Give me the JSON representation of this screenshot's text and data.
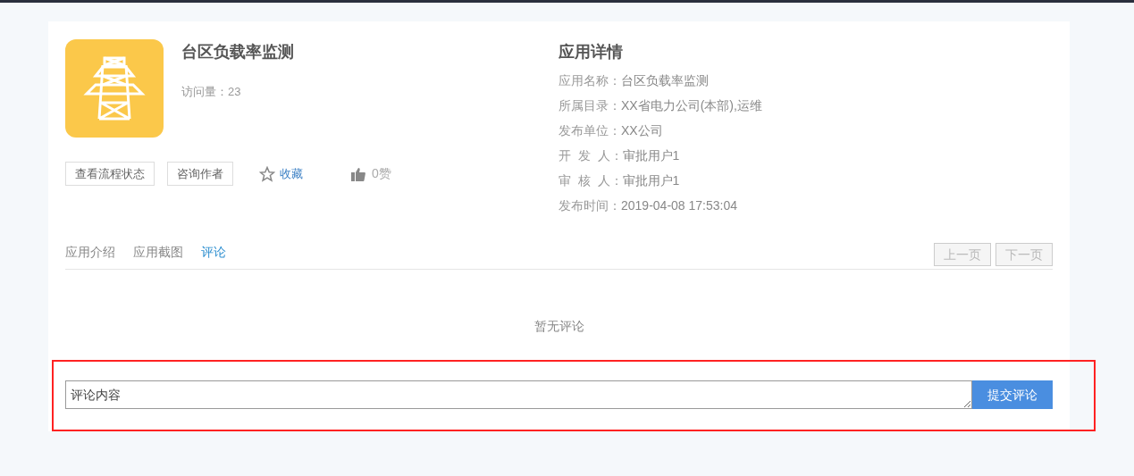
{
  "app": {
    "title": "台区负载率监测",
    "visits": "访问量：23"
  },
  "actions": [
    {
      "kind": "outlined",
      "label": "查看流程状态"
    },
    {
      "kind": "outlined",
      "label": "咨询作者"
    },
    {
      "kind": "favorite",
      "label": "收藏"
    },
    {
      "kind": "like",
      "label": "0赞"
    }
  ],
  "details": {
    "title": "应用详情",
    "rows": [
      {
        "label": "应用名称：",
        "value": "台区负载率监测"
      },
      {
        "label": "所属目录：",
        "value": "XX省电力公司(本部),运维"
      },
      {
        "label": "发布单位：",
        "value": "XX公司"
      },
      {
        "label": "开  发  人：",
        "value": "审批用户1"
      },
      {
        "label": "审  核  人：",
        "value": "审批用户1"
      },
      {
        "label": "发布时间：",
        "value": "2019-04-08 17:53:04"
      }
    ]
  },
  "tabs": [
    {
      "label": "应用介绍",
      "selected": false
    },
    {
      "label": "应用截图",
      "selected": false
    },
    {
      "label": "评论",
      "selected": true
    }
  ],
  "pager": [
    {
      "label": "上一页",
      "disabled": true
    },
    {
      "label": "下一页",
      "disabled": true
    }
  ],
  "empty_message": "暂无评论",
  "comment": {
    "placeholder": "评论内容",
    "submit": "提交评论"
  }
}
